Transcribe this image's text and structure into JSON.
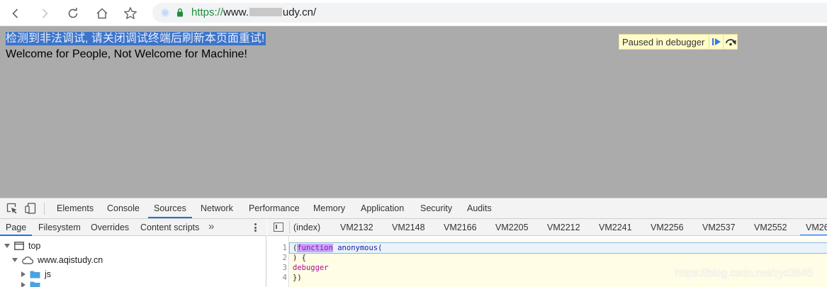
{
  "browser": {
    "url_scheme": "https://",
    "url_host_start": "www.",
    "url_host_end": "udy.cn/"
  },
  "page": {
    "warning": "检测到非法调试, 请关闭调试终端后刷新本页面重试!",
    "welcome": "Welcome for People, Not Welcome for Machine!"
  },
  "debugger_overlay": {
    "paused_label": "Paused in debugger"
  },
  "devtools": {
    "tabs": [
      "Elements",
      "Console",
      "Sources",
      "Network",
      "Performance",
      "Memory",
      "Application",
      "Security",
      "Audits"
    ],
    "active_tab": "Sources",
    "navigator_tabs": [
      "Page",
      "Filesystem",
      "Overrides",
      "Content scripts"
    ],
    "navigator_more": "»",
    "tree": {
      "top": "top",
      "domain": "www.aqistudy.cn",
      "folder": "js"
    },
    "file_tabs": [
      "(index)",
      "VM2132",
      "VM2148",
      "VM2166",
      "VM2205",
      "VM2212",
      "VM2241",
      "VM2256",
      "VM2537",
      "VM2552",
      "VM26"
    ],
    "code": {
      "line_numbers": [
        "1",
        "2",
        "3",
        "4"
      ],
      "line1_open": "(",
      "line1_keyword": "function",
      "line1_rest": " anonymous(",
      "line2": ") {",
      "line3": "debugger",
      "line4": "})"
    }
  },
  "watermark": "https://blog.csdn.net/zyc3545",
  "colors": {
    "accent": "#1a73e8",
    "overlay": "#ababab",
    "selection": "#3c74c9",
    "paused_bg": "#fffcc9"
  }
}
